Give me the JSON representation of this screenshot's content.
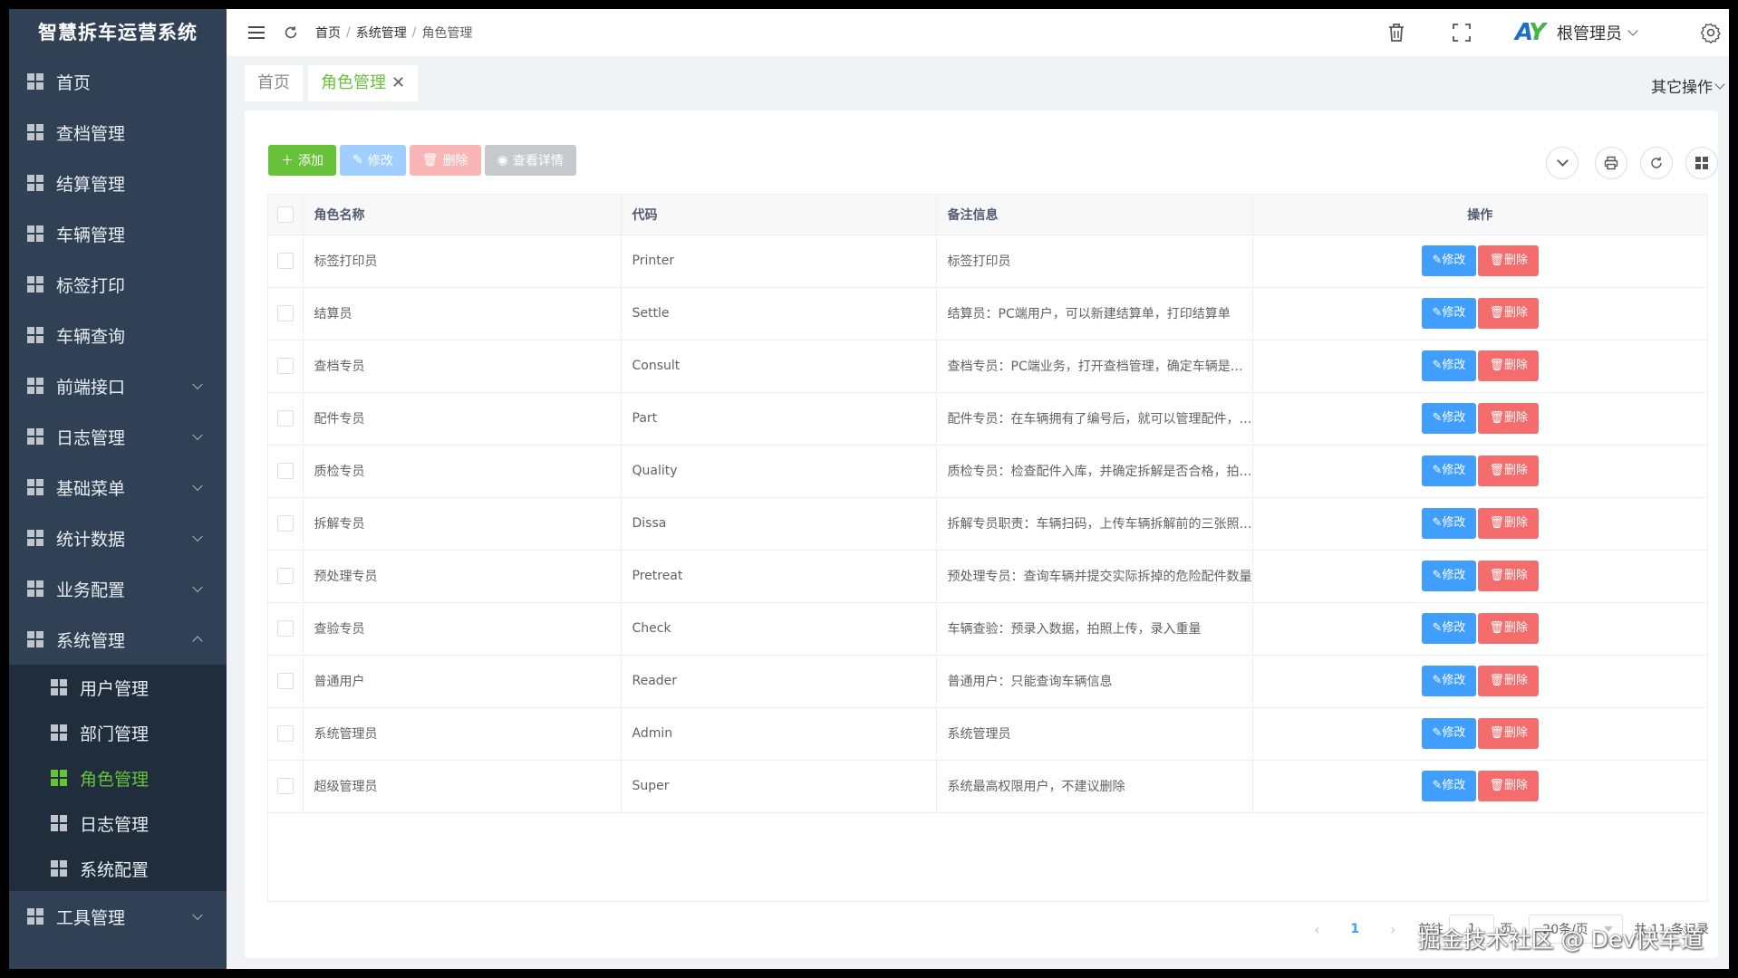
{
  "app": {
    "title": "智慧拆车运营系统"
  },
  "sidebar": {
    "items": [
      {
        "label": "首页",
        "expandable": false
      },
      {
        "label": "查档管理",
        "expandable": false
      },
      {
        "label": "结算管理",
        "expandable": false
      },
      {
        "label": "车辆管理",
        "expandable": false
      },
      {
        "label": "标签打印",
        "expandable": false
      },
      {
        "label": "车辆查询",
        "expandable": false
      },
      {
        "label": "前端接口",
        "expandable": true
      },
      {
        "label": "日志管理",
        "expandable": true
      },
      {
        "label": "基础菜单",
        "expandable": true
      },
      {
        "label": "统计数据",
        "expandable": true
      },
      {
        "label": "业务配置",
        "expandable": true
      },
      {
        "label": "系统管理",
        "expandable": true,
        "expanded": true
      },
      {
        "label": "用户管理",
        "sub": true
      },
      {
        "label": "部门管理",
        "sub": true
      },
      {
        "label": "角色管理",
        "sub": true,
        "active": true
      },
      {
        "label": "日志管理",
        "sub": true
      },
      {
        "label": "系统配置",
        "sub": true
      },
      {
        "label": "工具管理",
        "expandable": true
      }
    ]
  },
  "navbar": {
    "breadcrumb": [
      "首页",
      "系统管理",
      "角色管理"
    ],
    "user_name": "根管理员",
    "logo_text_a": "A",
    "logo_text_y": "Y"
  },
  "tags": {
    "items": [
      {
        "label": "首页",
        "active": false
      },
      {
        "label": "角色管理",
        "active": true,
        "close": "✕"
      }
    ],
    "other_ops": "其它操作"
  },
  "toolbar": {
    "add": "添加",
    "edit": "修改",
    "delete": "删除",
    "view": "查看详情"
  },
  "table": {
    "headers": {
      "name": "角色名称",
      "code": "代码",
      "remark": "备注信息",
      "op": "操作"
    },
    "op_edit": "修改",
    "op_delete": "删除",
    "rows": [
      {
        "name": "标签打印员",
        "code": "Printer",
        "remark": "标签打印员"
      },
      {
        "name": "结算员",
        "code": "Settle",
        "remark": "结算员：PC端用户，可以新建结算单，打印结算单"
      },
      {
        "name": "查档专员",
        "code": "Consult",
        "remark": "查档专员：PC端业务，打开查档管理，确定车辆是否可以..."
      },
      {
        "name": "配件专员",
        "code": "Part",
        "remark": "配件专员：在车辆拥有了编号后，就可以管理配件，直到..."
      },
      {
        "name": "质检专员",
        "code": "Quality",
        "remark": "质检专员：检查配件入库，并确定拆解是否合格，拍照上..."
      },
      {
        "name": "拆解专员",
        "code": "Dissa",
        "remark": "拆解专员职责：车辆扫码，上传车辆拆解前的三张照片，..."
      },
      {
        "name": "预处理专员",
        "code": "Pretreat",
        "remark": "预处理专员：查询车辆并提交实际拆掉的危险配件数量"
      },
      {
        "name": "查验专员",
        "code": "Check",
        "remark": "车辆查验：预录入数据，拍照上传，录入重量"
      },
      {
        "name": "普通用户",
        "code": "Reader",
        "remark": "普通用户：只能查询车辆信息"
      },
      {
        "name": "系统管理员",
        "code": "Admin",
        "remark": "系统管理员"
      },
      {
        "name": "超级管理员",
        "code": "Super",
        "remark": "系统最高权限用户，不建议删除"
      }
    ]
  },
  "pager": {
    "current": "1",
    "goto_label": "前往",
    "goto_value": "1",
    "page_label": "页",
    "page_size": "20条/页",
    "total": "共 11 条记录"
  },
  "watermark": "掘金技术社区 @ Dev快车道"
}
